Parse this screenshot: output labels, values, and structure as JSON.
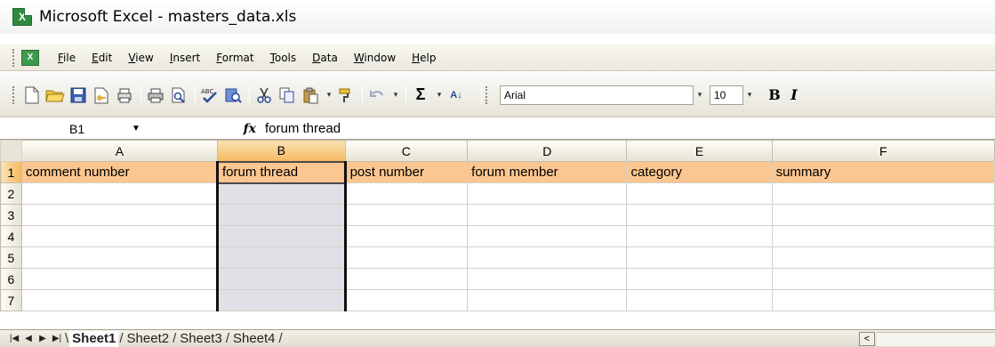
{
  "window": {
    "title": "Microsoft Excel - masters_data.xls",
    "app_icon": "X"
  },
  "menu": {
    "doc_icon": "X",
    "items": [
      "File",
      "Edit",
      "View",
      "Insert",
      "Format",
      "Tools",
      "Data",
      "Window",
      "Help"
    ]
  },
  "toolbar": {
    "font_name": "Arial",
    "font_size": "10",
    "bold_label": "B",
    "italic_label": "I",
    "autosum": "Σ",
    "sort": "A↓"
  },
  "formula_bar": {
    "cell_ref": "B1",
    "fx_label": "fx",
    "value": "forum thread"
  },
  "grid": {
    "columns": [
      "A",
      "B",
      "C",
      "D",
      "E",
      "F"
    ],
    "rows": [
      "1",
      "2",
      "3",
      "4",
      "5",
      "6",
      "7"
    ],
    "selected_column": "B",
    "selected_row": "1",
    "header_row": [
      "comment number",
      "forum thread",
      "post number",
      "forum member",
      "category",
      "summary"
    ]
  },
  "sheets": {
    "tabs": [
      "Sheet1",
      "Sheet2",
      "Sheet3",
      "Sheet4"
    ],
    "active": "Sheet1"
  },
  "colors": {
    "header_fill": "#fbc690",
    "selected_column_fill": "#e1e0e6",
    "excel_green": "#2e8b3e"
  }
}
